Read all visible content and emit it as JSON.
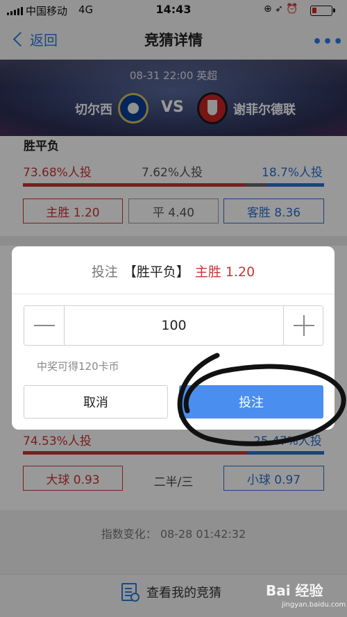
{
  "status_bar": {
    "carrier": "中国移动",
    "network": "4G",
    "time": "14:43",
    "icons": "⊕ ➶ ⏰"
  },
  "nav": {
    "back_label": "返回",
    "title": "竞猜详情",
    "more": "•••"
  },
  "match": {
    "info": "08-31 22:00 英超",
    "home_team": "切尔西",
    "away_team": "谢菲尔德联",
    "vs": "VS"
  },
  "market1": {
    "title": "胜平负",
    "home_pct_text": "73.68%人投",
    "draw_pct_text": "7.62%人投",
    "away_pct_text": "18.7%人投",
    "home_share": 0.7368,
    "draw_share": 0.0762,
    "away_share": 0.187,
    "home_btn": "主胜 1.20",
    "draw_btn": "平 4.40",
    "away_btn": "客胜 8.36"
  },
  "market2": {
    "over_pct_text": "74.53%人投",
    "under_pct_text": "25.47%人投",
    "over_share": 0.7453,
    "under_share": 0.2547,
    "over_btn": "大球 0.93",
    "handicap": "二半/三",
    "under_btn": "小球 0.97"
  },
  "index_change": "指数变化：  08-28 01:42:32",
  "bottom": {
    "my_bets": "查看我的竞猜"
  },
  "dialog": {
    "title_prefix": "投注",
    "title_market": "【胜平负】",
    "title_pick": "主胜 1.20",
    "amount": "100",
    "win_hint": "中奖可得120卡币",
    "cancel": "取消",
    "confirm": "投注"
  },
  "watermark": {
    "text": "Bai 经验",
    "sub": "jingyan.baidu.com"
  },
  "colors": {
    "home_red": "#c83535",
    "away_blue": "#2c6fd1",
    "confirm_blue": "#4a8ef0",
    "nav_blue": "#2c7be5"
  }
}
